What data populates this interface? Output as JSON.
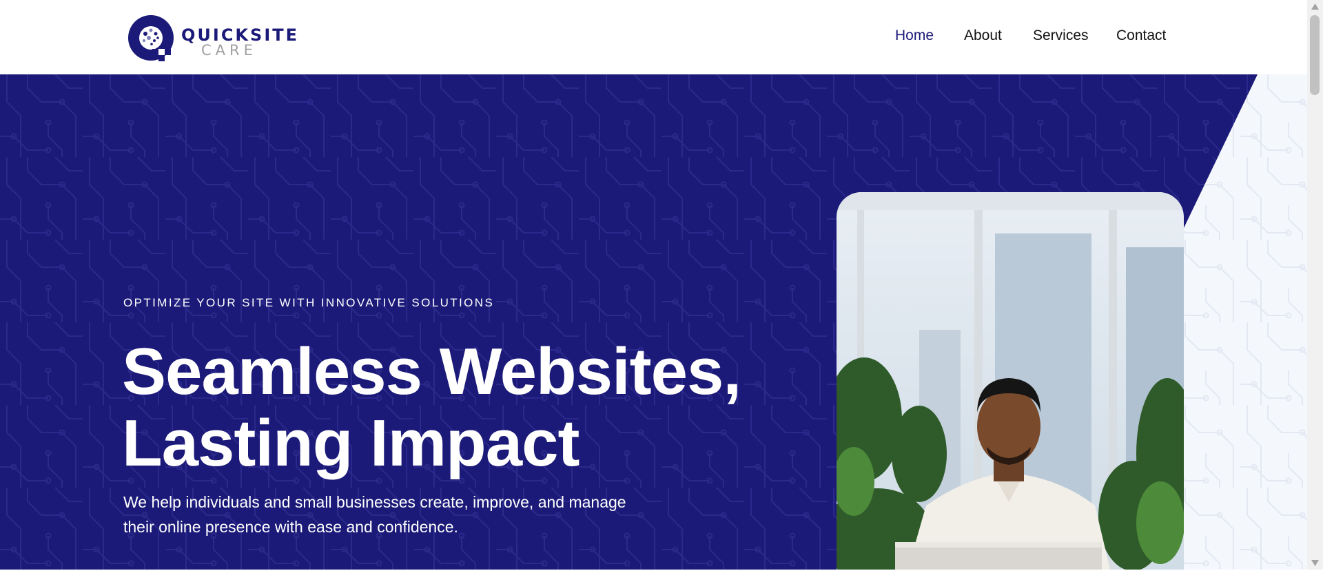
{
  "header": {
    "logo": {
      "word1": "QUICKSITE",
      "word2": "CARE",
      "mark_color": "#1b1a78",
      "accent_color": "#a0a0a0"
    },
    "nav": {
      "items": [
        {
          "label": "Home",
          "active": true
        },
        {
          "label": "About",
          "active": false
        },
        {
          "label": "Services",
          "active": false
        },
        {
          "label": "Contact",
          "active": false
        }
      ]
    }
  },
  "hero": {
    "eyebrow": "OPTIMIZE YOUR SITE WITH INNOVATIVE SOLUTIONS",
    "headline_line1": "Seamless Websites,",
    "headline_line2": "Lasting Impact",
    "subtext_line1": "We help individuals and small businesses create, improve, and manage",
    "subtext_line2": "their online presence with ease and confidence.",
    "background_color": "#1b1a78",
    "side_color": "#f4f7fb",
    "photo_icon": "man-at-laptop-photo"
  },
  "colors": {
    "brand": "#1b1a78",
    "text_dark": "#111111",
    "white": "#ffffff"
  }
}
